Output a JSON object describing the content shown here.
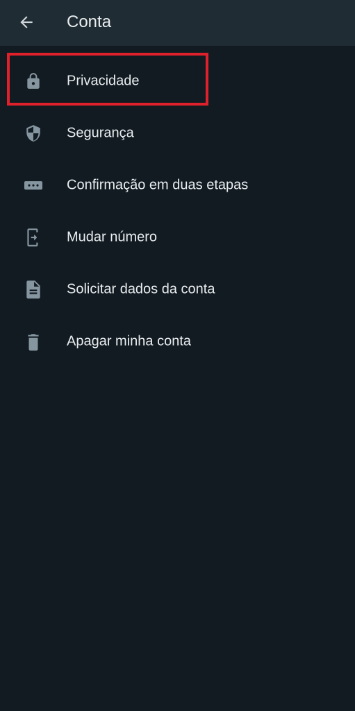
{
  "app_bar": {
    "title": "Conta",
    "back_icon": "arrow-left-icon"
  },
  "menu": {
    "items": [
      {
        "label": "Privacidade",
        "icon": "lock-icon"
      },
      {
        "label": "Segurança",
        "icon": "shield-icon"
      },
      {
        "label": "Confirmação em duas etapas",
        "icon": "password-dots-icon"
      },
      {
        "label": "Mudar número",
        "icon": "phone-change-icon"
      },
      {
        "label": "Solicitar dados da conta",
        "icon": "document-icon"
      },
      {
        "label": "Apagar minha conta",
        "icon": "trash-icon"
      }
    ]
  },
  "colors": {
    "background": "#121b22",
    "app_bar": "#1f2c33",
    "text": "#e9edef",
    "icon": "#8696a0",
    "highlight": "#e0202b"
  }
}
